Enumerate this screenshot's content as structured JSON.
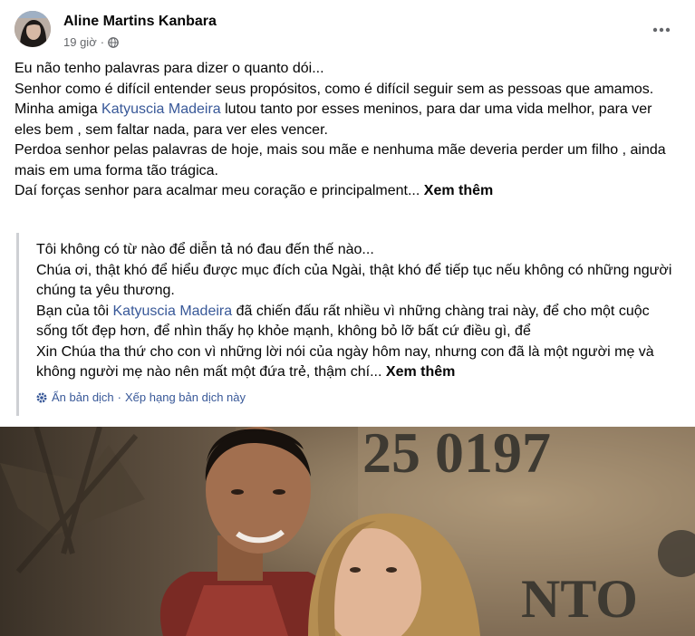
{
  "post": {
    "author": "Aline Martins Kanbara",
    "time": "19 giờ",
    "separator": "·",
    "audience_icon": "globe-icon",
    "more_icon": "more-horizontal-icon"
  },
  "original": {
    "line1": "Eu não tenho palavras para dizer o quanto dói...",
    "line2": "Senhor como é difícil entender seus propósitos, como é difícil seguir sem as pessoas que amamos.",
    "line3_before": "Minha amiga ",
    "line3_mention": "Katyuscia Madeira",
    "line3_after": "  lutou tanto por esses meninos, para dar uma vida melhor, para ver eles bem , sem faltar nada, para ver eles vencer.",
    "line4": "Perdoa senhor pelas palavras de hoje, mais sou mãe e nenhuma mãe deveria perder um filho , ainda mais em uma forma tão trágica.",
    "line5": "Daí forças senhor para acalmar meu coração e principalment... ",
    "see_more": "Xem thêm"
  },
  "translation": {
    "line1": "Tôi không có từ nào để diễn tả nó đau đến thế nào...",
    "line2": "Chúa ơi, thật khó để hiểu được mục đích của Ngài, thật khó để tiếp tục nếu không có những người chúng ta yêu thương.",
    "line3_before": "Bạn của tôi ",
    "line3_mention": "Katyuscia Madeira",
    "line3_after": " đã chiến đấu rất nhiều vì những chàng trai này, để cho một cuộc sống tốt đẹp hơn, để nhìn thấy họ khỏe mạnh, không bỏ lỡ bất cứ điều gì, để",
    "line4": "Xin Chúa tha thứ cho con vì những lời nói của ngày hôm nay, nhưng con đã là một người mẹ và không người mẹ nào nên mất một đứa trẻ, thậm chí... ",
    "see_more": "Xem thêm",
    "settings_icon": "gear-icon",
    "hide_label": "Ẩn bản dịch",
    "dot": "·",
    "rate_label": "Xếp hạng bản dịch này"
  },
  "photo": {
    "sign_text_1": "25 0197",
    "sign_text_2": "NTO"
  },
  "colors": {
    "link": "#385898",
    "secondary_text": "#65676b",
    "text": "#050505"
  }
}
